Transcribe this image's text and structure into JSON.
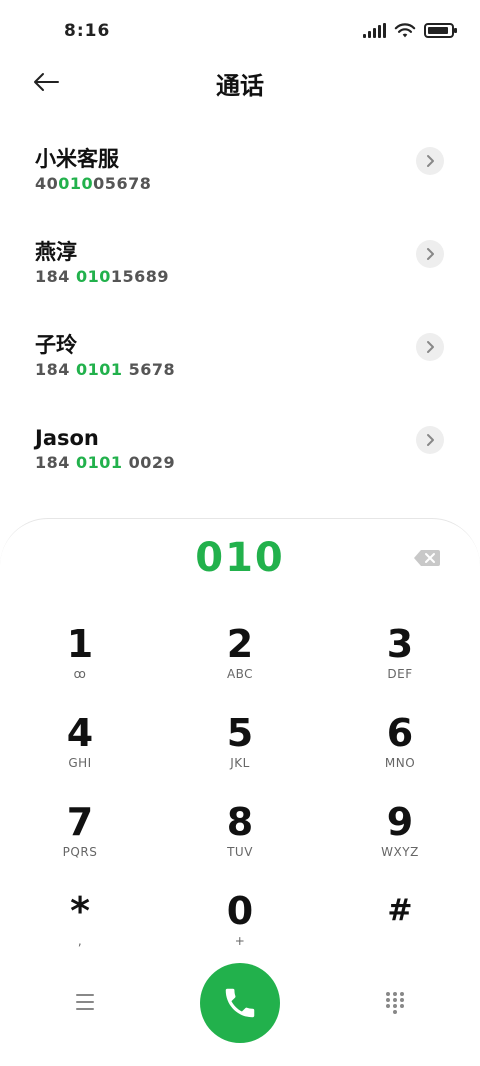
{
  "status_bar": {
    "time": "8:16",
    "icons": [
      "signal-icon",
      "wifi-icon",
      "battery-icon"
    ],
    "battery_level": 0.9
  },
  "header": {
    "back_icon": "arrow-left-icon",
    "title": "通话"
  },
  "contacts": [
    {
      "name": "小米客服",
      "number_prefix": "40",
      "number_match": "010",
      "number_suffix": "05678"
    },
    {
      "name": "燕淳",
      "number_prefix": "184 ",
      "number_match": "010",
      "number_suffix": "15689"
    },
    {
      "name": "子玲",
      "number_prefix": "184 ",
      "number_match": "0101",
      "number_suffix": " 5678"
    },
    {
      "name": "Jason",
      "number_prefix": "184 ",
      "number_match": "0101",
      "number_suffix": " 0029"
    }
  ],
  "dialpad": {
    "input_value": "010",
    "keys": [
      {
        "digit": "1",
        "letters": "ꝏ"
      },
      {
        "digit": "2",
        "letters": "ABC"
      },
      {
        "digit": "3",
        "letters": "DEF"
      },
      {
        "digit": "4",
        "letters": "GHI"
      },
      {
        "digit": "5",
        "letters": "JKL"
      },
      {
        "digit": "6",
        "letters": "MNO"
      },
      {
        "digit": "7",
        "letters": "PQRS"
      },
      {
        "digit": "8",
        "letters": "TUV"
      },
      {
        "digit": "9",
        "letters": "WXYZ"
      },
      {
        "digit": "*",
        "letters": ","
      },
      {
        "digit": "0",
        "letters": "+"
      },
      {
        "digit": "#",
        "letters": ""
      }
    ]
  },
  "colors": {
    "accent": "#22b14c",
    "text": "#111111",
    "secondary": "#555555"
  }
}
